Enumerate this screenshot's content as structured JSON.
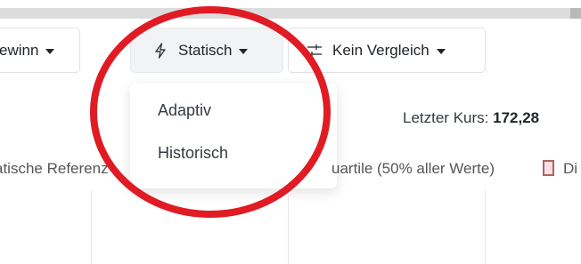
{
  "toolbar": {
    "metric_label": "ewinn",
    "mode_label": "Statisch",
    "mode_icon": "lightning-bolt-icon",
    "compare_label": "Kein Vergleich",
    "compare_icon": "sliders-icon"
  },
  "mode_menu": {
    "items": [
      "Adaptiv",
      "Historisch"
    ]
  },
  "summary": {
    "last_price_label": "Letzter Kurs:",
    "last_price_value": "172,28"
  },
  "legend": {
    "static_ref_text": "atische Referenz",
    "quartile_text": "uartile (50% aller Werte)",
    "right_text": "Di"
  },
  "colors": {
    "annotation": "#e01b24",
    "swatch_fill": "#f6e0e3",
    "swatch_border": "#b0606a"
  }
}
